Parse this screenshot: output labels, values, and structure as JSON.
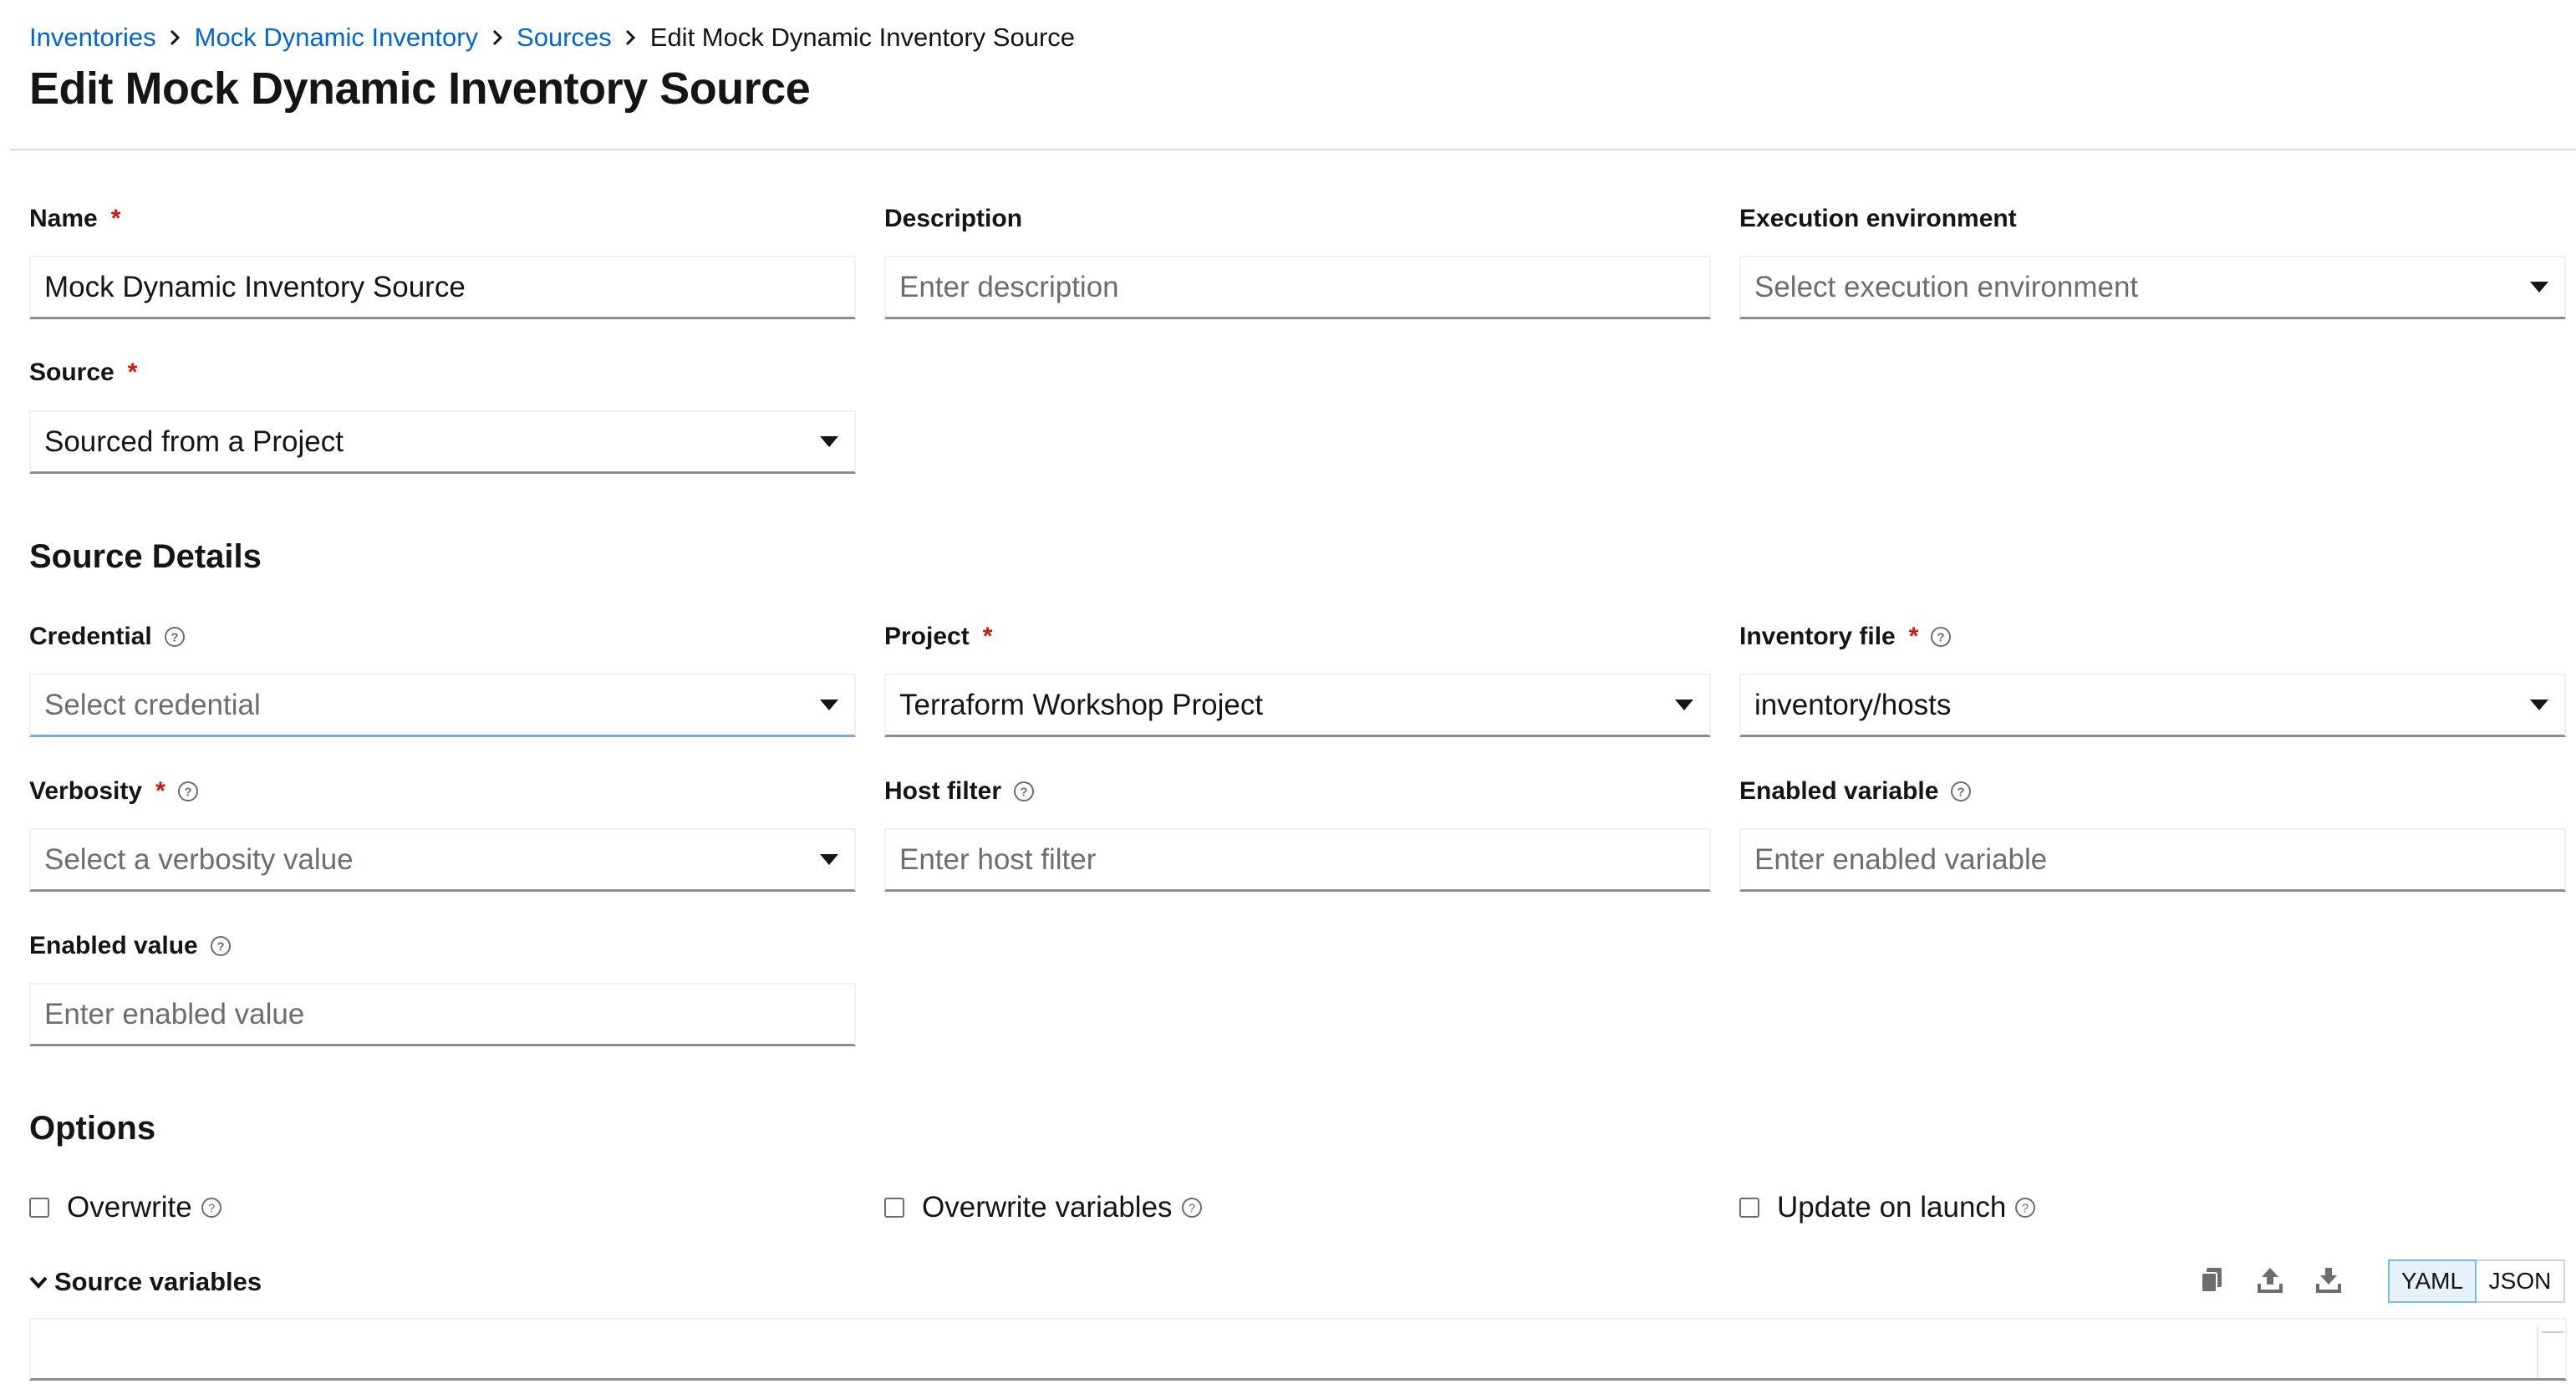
{
  "breadcrumb": {
    "items": [
      {
        "label": "Inventories"
      },
      {
        "label": "Mock Dynamic Inventory"
      },
      {
        "label": "Sources"
      },
      {
        "label": "Edit Mock Dynamic Inventory Source"
      }
    ]
  },
  "page_title": "Edit Mock Dynamic Inventory Source",
  "form": {
    "name": {
      "label": "Name",
      "required_mark": "*",
      "value": "Mock Dynamic Inventory Source"
    },
    "description": {
      "label": "Description",
      "placeholder": "Enter description"
    },
    "execution_environment": {
      "label": "Execution environment",
      "placeholder": "Select execution environment"
    },
    "source": {
      "label": "Source",
      "required_mark": "*",
      "value": "Sourced from a Project"
    }
  },
  "source_details": {
    "heading": "Source Details",
    "credential": {
      "label": "Credential",
      "placeholder": "Select credential"
    },
    "project": {
      "label": "Project",
      "required_mark": "*",
      "value": "Terraform Workshop Project"
    },
    "inventory_file": {
      "label": "Inventory file",
      "required_mark": "*",
      "value": "inventory/hosts"
    },
    "verbosity": {
      "label": "Verbosity",
      "required_mark": "*",
      "placeholder": "Select a verbosity value"
    },
    "host_filter": {
      "label": "Host filter",
      "placeholder": "Enter host filter"
    },
    "enabled_variable": {
      "label": "Enabled variable",
      "placeholder": "Enter enabled variable"
    },
    "enabled_value": {
      "label": "Enabled value",
      "placeholder": "Enter enabled value"
    }
  },
  "options": {
    "heading": "Options",
    "overwrite": {
      "label": "Overwrite",
      "checked": false
    },
    "overwrite_variables": {
      "label": "Overwrite variables",
      "checked": false
    },
    "update_on_launch": {
      "label": "Update on launch",
      "checked": false
    }
  },
  "source_variables": {
    "label": "Source variables",
    "toggle": {
      "yaml": "YAML",
      "json": "JSON",
      "selected": "YAML"
    },
    "icons": [
      "copy-icon",
      "upload-icon",
      "download-icon"
    ]
  },
  "colors": {
    "link": "#0066cc",
    "required": "#c9190b",
    "text": "#151515",
    "placeholder": "#6a6e73"
  }
}
